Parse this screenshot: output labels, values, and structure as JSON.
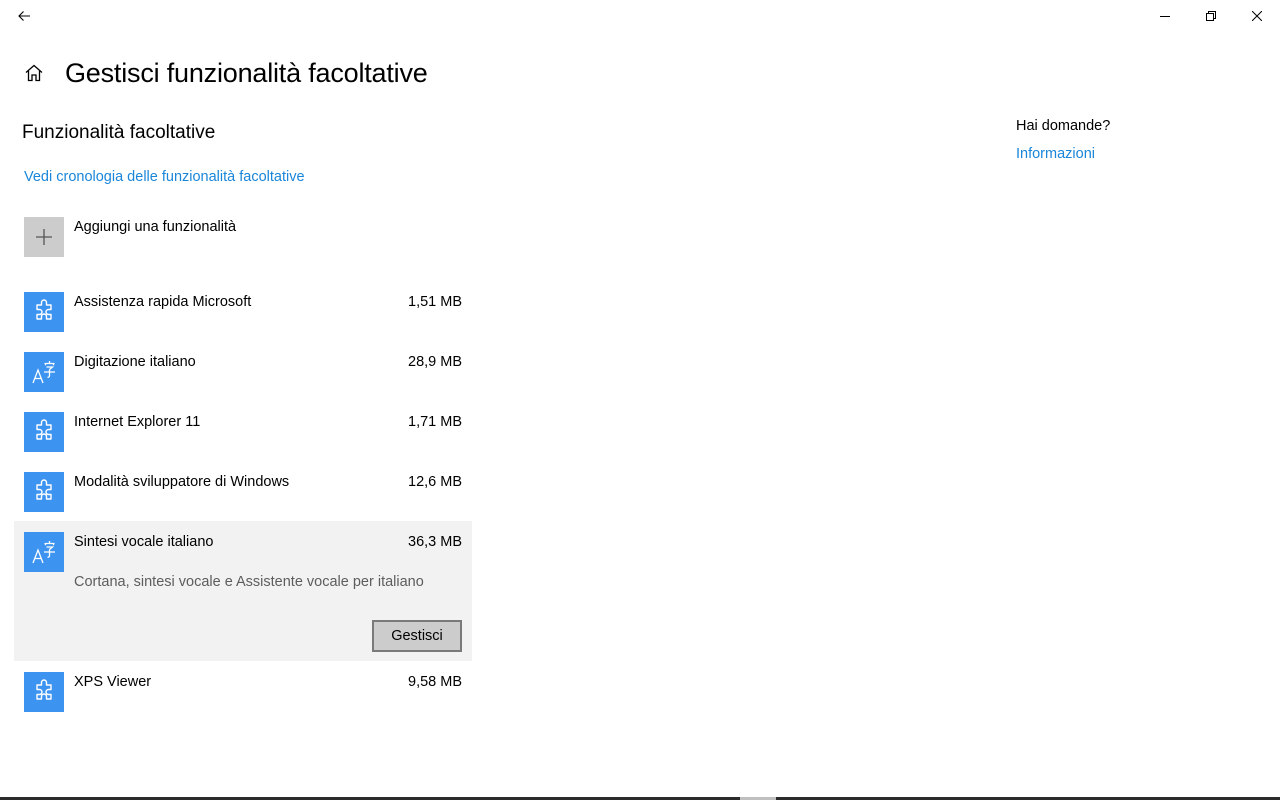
{
  "window": {
    "back_icon": "back-arrow-icon",
    "controls": [
      "minimize-icon",
      "restore-icon",
      "close-icon"
    ]
  },
  "header": {
    "home_icon": "home-icon",
    "title": "Gestisci funzionalità facoltative"
  },
  "main": {
    "section_title": "Funzionalità facoltative",
    "history_link": "Vedi cronologia delle funzionalità facoltative",
    "add_feature_label": "Aggiungi una funzionalità",
    "features": [
      {
        "name": "Assistenza rapida Microsoft",
        "size": "1,51 MB",
        "icon": "puzzle-icon"
      },
      {
        "name": "Digitazione italiano",
        "size": "28,9 MB",
        "icon": "language-icon"
      },
      {
        "name": "Internet Explorer 11",
        "size": "1,71 MB",
        "icon": "puzzle-icon"
      },
      {
        "name": "Modalità sviluppatore di Windows",
        "size": "12,6 MB",
        "icon": "puzzle-icon"
      },
      {
        "name": "Sintesi vocale italiano",
        "size": "36,3 MB",
        "icon": "language-icon",
        "description": "Cortana, sintesi vocale e Assistente vocale per italiano",
        "button_label": "Gestisci",
        "expanded": true
      },
      {
        "name": "XPS Viewer",
        "size": "9,58 MB",
        "icon": "puzzle-icon"
      }
    ]
  },
  "sidebar": {
    "question": "Hai domande?",
    "link": "Informazioni"
  },
  "colors": {
    "accent": "#3c93f0",
    "link": "#1a86d9",
    "selected_bg": "#f2f2f2",
    "add_tile_bg": "#cccccc"
  }
}
